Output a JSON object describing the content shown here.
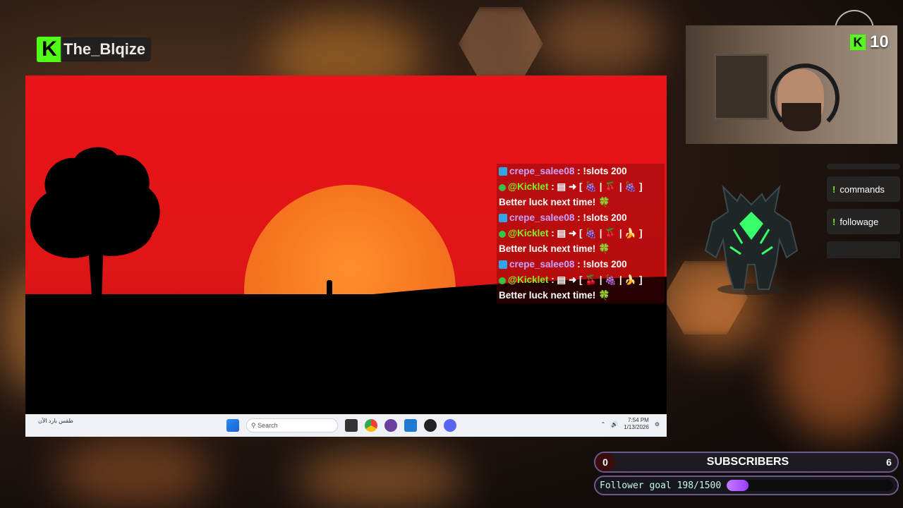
{
  "channel": {
    "name": "The_Blqize",
    "logo_letter": "K"
  },
  "chat": [
    {
      "type": "cmd",
      "user": "crepe_salee08",
      "text": " : !slots 200",
      "color": "purple",
      "badge": "blue"
    },
    {
      "type": "bot",
      "user": "@Kicklet",
      "text": " : ▤ ➜ [ 🍇 | 🍒 | 🍇 ]",
      "color": "green",
      "badge": "check",
      "result": "Better luck next time! 🍀"
    },
    {
      "type": "cmd",
      "user": "crepe_salee08",
      "text": " : !slots 200",
      "color": "purple",
      "badge": "blue"
    },
    {
      "type": "bot",
      "user": "@Kicklet",
      "text": " : ▤ ➜ [ 🍇 | 🍒 | 🍌 ]",
      "color": "green",
      "badge": "check",
      "result": "Better luck next time! 🍀"
    },
    {
      "type": "cmd",
      "user": "crepe_salee08",
      "text": " : !slots 200",
      "color": "purple",
      "badge": "blue"
    },
    {
      "type": "bot",
      "user": "@Kicklet",
      "text": " : ▤ ➜ [ 🍒 | 🍇 | 🍌 ]",
      "color": "green",
      "badge": "check",
      "result": "Better luck next time! 🍀"
    }
  ],
  "taskbar": {
    "weather": "طقس بارد الآن",
    "search_placeholder": "Search",
    "time": "7:54 PM",
    "date": "1/13/2026"
  },
  "viewers": {
    "count": "10",
    "icon": "kick-logo-icon"
  },
  "commands": [
    "commands",
    "followage"
  ],
  "subscribers": {
    "title": "SUBSCRIBERS",
    "left": "0",
    "right": "6"
  },
  "goal": {
    "label": "Follower goal 198/1500",
    "progress": 0.132
  },
  "colors": {
    "kick_green": "#53fc18",
    "sky_red": "#e8141a",
    "goal_purple": "#b15cff"
  }
}
